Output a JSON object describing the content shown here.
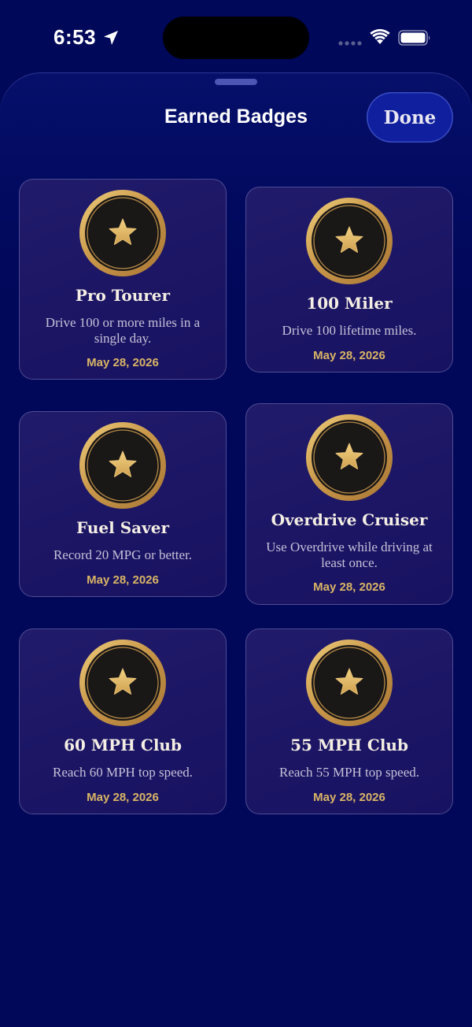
{
  "status_bar": {
    "time": "6:53",
    "location_icon": "location-arrow-icon",
    "signal_icon": "cellular-signal-icon",
    "wifi_icon": "wifi-icon",
    "battery_icon": "battery-icon"
  },
  "sheet": {
    "title": "Earned Badges",
    "done_label": "Done"
  },
  "colors": {
    "background": "#000859",
    "card": "#1e1867",
    "gold": "#d9b564",
    "done_button": "#0f1f9e"
  },
  "badges": [
    {
      "name": "Pro Tourer",
      "description": "Drive 100 or more miles in a single day.",
      "date": "May 28, 2026",
      "icon": "star-medal-icon"
    },
    {
      "name": "100 Miler",
      "description": "Drive 100 lifetime miles.",
      "date": "May 28, 2026",
      "icon": "star-medal-icon"
    },
    {
      "name": "Fuel Saver",
      "description": "Record 20 MPG or better.",
      "date": "May 28, 2026",
      "icon": "star-medal-icon"
    },
    {
      "name": "Overdrive Cruiser",
      "description": "Use Overdrive while driving at least once.",
      "date": "May 28, 2026",
      "icon": "star-medal-icon"
    },
    {
      "name": "60 MPH Club",
      "description": "Reach 60 MPH top speed.",
      "date": "May 28, 2026",
      "icon": "star-medal-icon"
    },
    {
      "name": "55 MPH Club",
      "description": "Reach 55 MPH top speed.",
      "date": "May 28, 2026",
      "icon": "star-medal-icon"
    }
  ]
}
